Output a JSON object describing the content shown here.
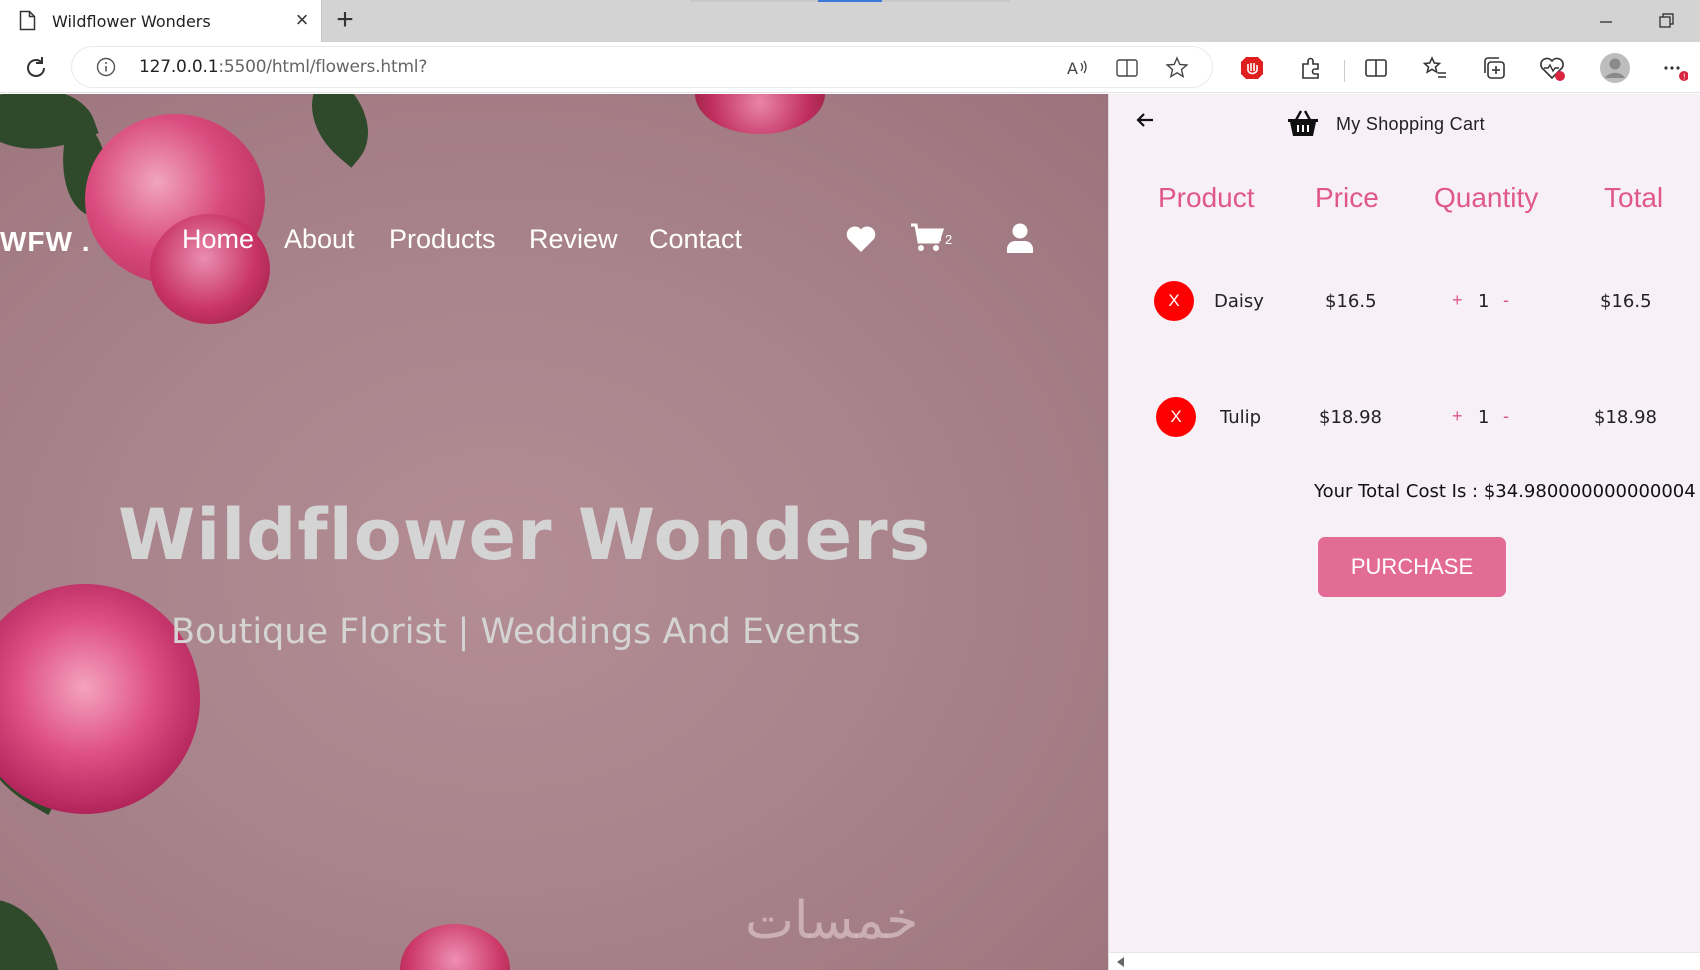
{
  "browser": {
    "tab_title": "Wildflower Wonders",
    "url_host": "127.0.0.1",
    "url_rest": ":5500/html/flowers.html?"
  },
  "site": {
    "brand": "WFW .",
    "nav": [
      "Home",
      "About",
      "Products",
      "Review",
      "Contact"
    ],
    "cart_count": "2",
    "hero_title": "Wildflower Wonders",
    "hero_subtitle": "Boutique Florist | Weddings And Events",
    "watermark": "خمسات"
  },
  "cart": {
    "title": "My Shopping Cart",
    "headers": [
      "Product",
      "Price",
      "Quantity",
      "Total"
    ],
    "remove_label": "X",
    "plus_label": "+",
    "minus_label": "-",
    "items": [
      {
        "name": "Daisy",
        "price": "$16.5",
        "qty": "1",
        "total": "$16.5"
      },
      {
        "name": "Tulip",
        "price": "$18.98",
        "qty": "1",
        "total": "$18.98"
      }
    ],
    "total_text": "Your Total Cost Is : $34.980000000000004",
    "purchase_label": "PURCHASE"
  },
  "colors": {
    "accent": "#e0588a",
    "button": "#e36c95",
    "remove": "#ff0000",
    "panel_bg": "#f8f0f7"
  }
}
